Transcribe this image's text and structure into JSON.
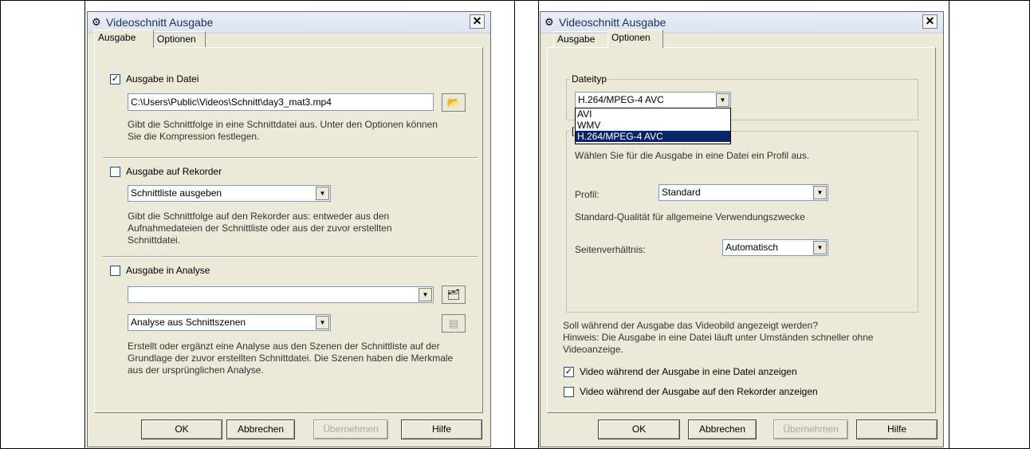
{
  "left": {
    "title": "Videoschnitt Ausgabe",
    "tabs": [
      "Ausgabe",
      "Optionen"
    ],
    "file_section": {
      "checkbox_label": "Ausgabe in Datei",
      "checked": true,
      "path": "C:\\Users\\Public\\Videos\\Schnitt\\day3_mat3.mp4",
      "description": "Gibt die Schnittfolge in eine Schnittdatei aus. Unter den Optionen können Sie die Kompression festlegen."
    },
    "recorder_section": {
      "checkbox_label": "Ausgabe auf Rekorder",
      "checked": false,
      "combo_value": "Schnittliste ausgeben",
      "description": "Gibt die Schnittfolge auf den Rekorder aus: entweder aus den Aufnahmedateien der Schnittliste oder aus der zuvor erstellten Schnittdatei."
    },
    "analysis_section": {
      "checkbox_label": "Ausgabe in Analyse",
      "checked": false,
      "combo1_value": "",
      "combo2_value": "Analyse aus Schnittszenen",
      "description": "Erstellt oder ergänzt eine Analyse aus den Szenen der Schnittliste auf der Grundlage der zuvor erstellten Schnittdatei. Die Szenen haben die Merkmale aus der ursprünglichen Analyse."
    },
    "buttons": {
      "ok": "OK",
      "cancel": "Abbrechen",
      "apply": "Übernehmen",
      "help": "Hilfe"
    }
  },
  "right": {
    "title": "Videoschnitt Ausgabe",
    "tabs": [
      "Ausgabe",
      "Optionen"
    ],
    "filetype_group": {
      "title": "Dateityp",
      "selected": "H.264/MPEG-4 AVC",
      "options": [
        "AVI",
        "WMV",
        "H.264/MPEG-4 AVC"
      ]
    },
    "profile_group": {
      "title_partial": "[",
      "hint": "Wählen Sie für die Ausgabe in eine Datei ein Profil aus.",
      "profile_label": "Profil:",
      "profile_value": "Standard",
      "profile_desc": "Standard-Qualität für allgemeine Verwendungszwecke",
      "aspect_label": "Seitenverhältnis:",
      "aspect_value": "Automatisch"
    },
    "question": "Soll während der Ausgabe das Videobild angezeigt werden?",
    "hint": "Hinweis: Die Ausgabe in eine Datei läuft unter Umständen schneller ohne Videoanzeige.",
    "checkbox_file": {
      "label": "Video während der Ausgabe in eine Datei anzeigen",
      "checked": true
    },
    "checkbox_recorder": {
      "label": "Video während der Ausgabe auf den Rekorder anzeigen",
      "checked": false
    },
    "buttons": {
      "ok": "OK",
      "cancel": "Abbrechen",
      "apply": "Übernehmen",
      "help": "Hilfe"
    }
  },
  "icons": {
    "app": "app-icon",
    "close": "close-icon",
    "folder": "folder-open-icon",
    "browse": "browse-icon",
    "disabled": "disabled-icon"
  },
  "glyphs": {
    "close": "✕",
    "check": "✓",
    "arrow": "▼",
    "app": "⚙",
    "folder": "📂",
    "analysis": "🗂",
    "analysis_disabled": "▤"
  }
}
